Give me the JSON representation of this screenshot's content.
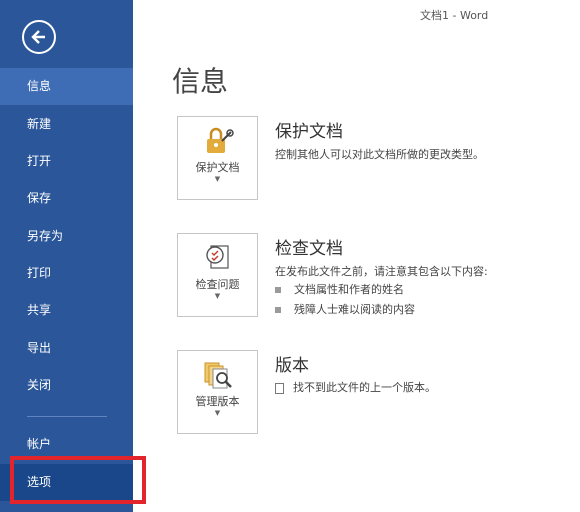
{
  "window": {
    "title": "文档1 - Word"
  },
  "sidebar": {
    "back_icon": "back-arrow-icon",
    "items": [
      {
        "label": "信息"
      },
      {
        "label": "新建"
      },
      {
        "label": "打开"
      },
      {
        "label": "保存"
      },
      {
        "label": "另存为"
      },
      {
        "label": "打印"
      },
      {
        "label": "共享"
      },
      {
        "label": "导出"
      },
      {
        "label": "关闭"
      }
    ],
    "bottom_items": [
      {
        "label": "帐户"
      },
      {
        "label": "选项"
      }
    ],
    "active_item": "信息",
    "highlight_color": "#e2242c"
  },
  "main": {
    "title": "信息",
    "protect": {
      "button_label": "保护文档",
      "title": "保护文档",
      "description": "控制其他人可以对此文档所做的更改类型。",
      "icon": "lock-key-icon"
    },
    "inspect": {
      "button_label": "检查问题",
      "title": "检查文档",
      "description": "在发布此文件之前，请注意其包含以下内容:",
      "bullets": [
        "文档属性和作者的姓名",
        "残障人士难以阅读的内容"
      ],
      "icon": "checklist-icon"
    },
    "versions": {
      "button_label": "管理版本",
      "title": "版本",
      "info": "找不到此文件的上一个版本。",
      "icon": "documents-magnifier-icon"
    }
  },
  "colors": {
    "sidebar_bg": "#2b579a",
    "accent": "#d79a2a"
  }
}
